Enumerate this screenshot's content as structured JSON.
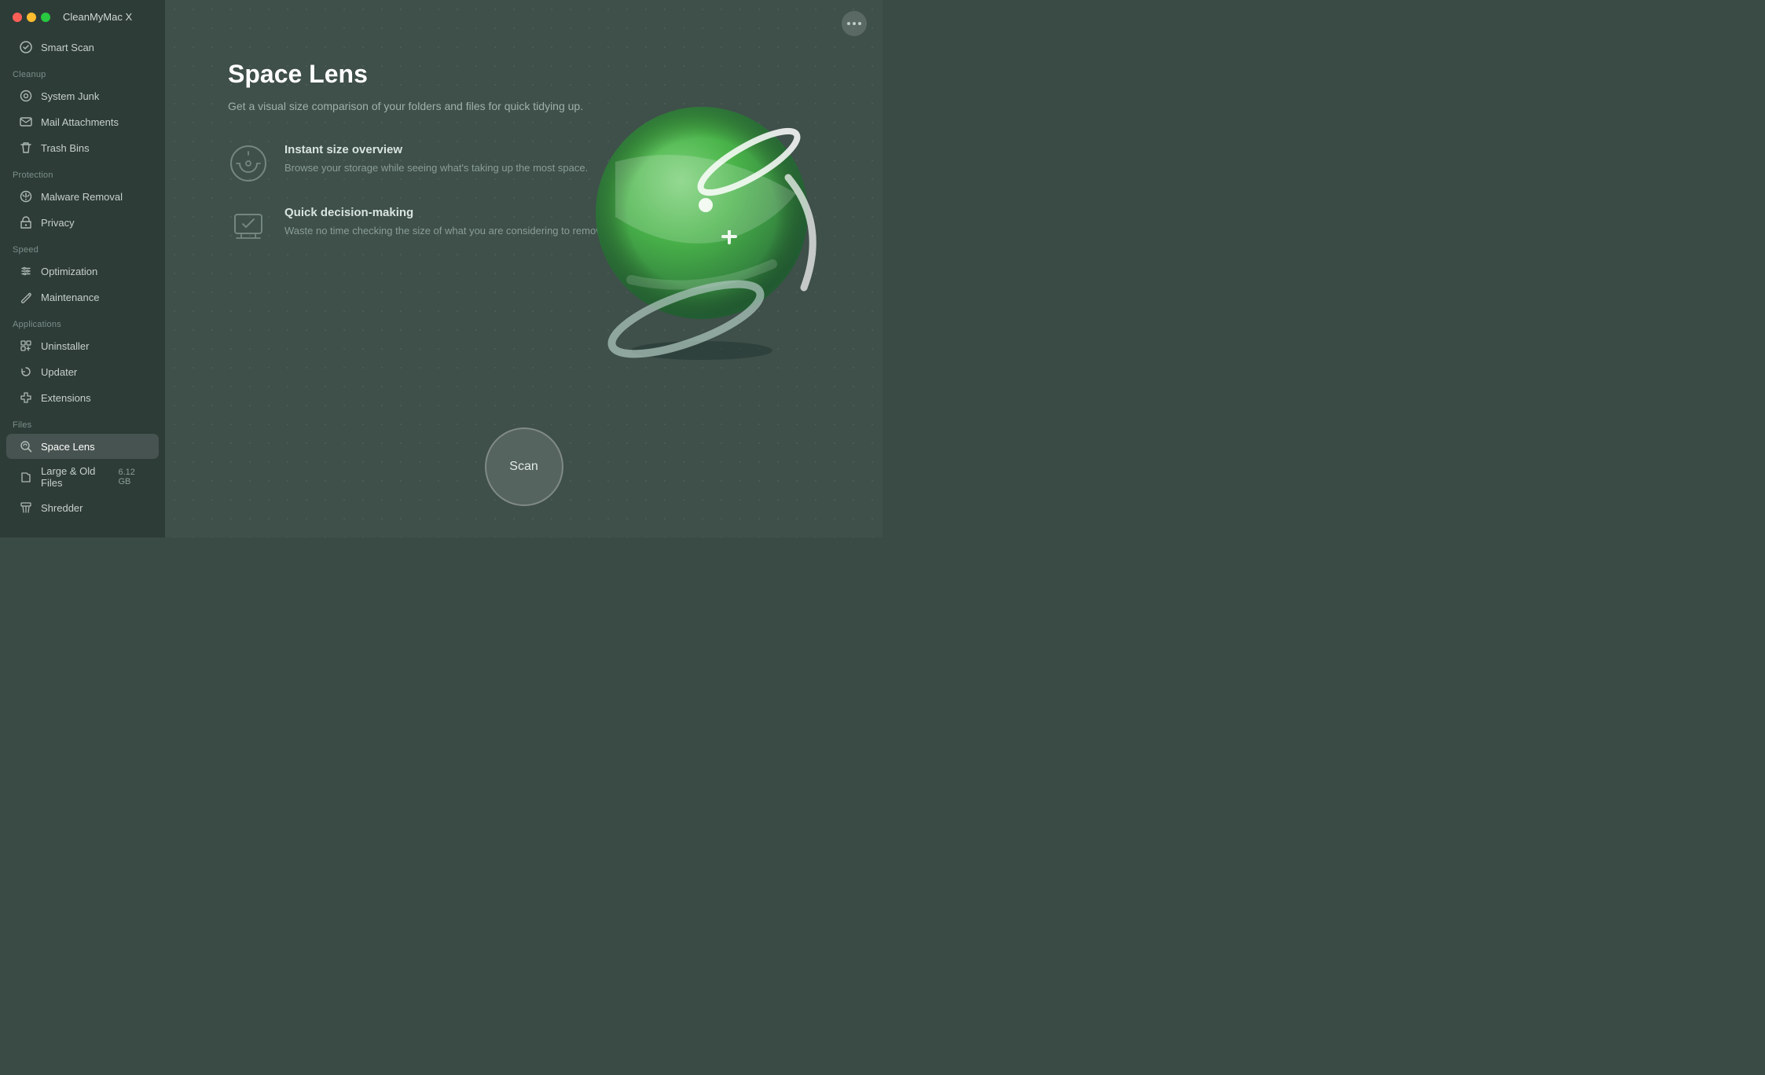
{
  "app": {
    "title": "CleanMyMac X"
  },
  "sidebar": {
    "smart_scan_label": "Smart Scan",
    "sections": [
      {
        "label": "Cleanup",
        "key": "cleanup",
        "items": [
          {
            "key": "system-junk",
            "label": "System Junk",
            "icon": "system-junk-icon"
          },
          {
            "key": "mail-attachments",
            "label": "Mail Attachments",
            "icon": "mail-icon"
          },
          {
            "key": "trash-bins",
            "label": "Trash Bins",
            "icon": "trash-icon"
          }
        ]
      },
      {
        "label": "Protection",
        "key": "protection",
        "items": [
          {
            "key": "malware-removal",
            "label": "Malware Removal",
            "icon": "malware-icon"
          },
          {
            "key": "privacy",
            "label": "Privacy",
            "icon": "privacy-icon"
          }
        ]
      },
      {
        "label": "Speed",
        "key": "speed",
        "items": [
          {
            "key": "optimization",
            "label": "Optimization",
            "icon": "optimization-icon"
          },
          {
            "key": "maintenance",
            "label": "Maintenance",
            "icon": "maintenance-icon"
          }
        ]
      },
      {
        "label": "Applications",
        "key": "applications",
        "items": [
          {
            "key": "uninstaller",
            "label": "Uninstaller",
            "icon": "uninstaller-icon"
          },
          {
            "key": "updater",
            "label": "Updater",
            "icon": "updater-icon"
          },
          {
            "key": "extensions",
            "label": "Extensions",
            "icon": "extensions-icon"
          }
        ]
      },
      {
        "label": "Files",
        "key": "files",
        "items": [
          {
            "key": "space-lens",
            "label": "Space Lens",
            "icon": "space-lens-icon",
            "active": true
          },
          {
            "key": "large-old-files",
            "label": "Large & Old Files",
            "icon": "large-files-icon",
            "badge": "6.12 GB"
          },
          {
            "key": "shredder",
            "label": "Shredder",
            "icon": "shredder-icon"
          }
        ]
      }
    ]
  },
  "main": {
    "title": "Space Lens",
    "subtitle": "Get a visual size comparison of your folders and files for quick tidying up.",
    "features": [
      {
        "key": "instant-size",
        "title": "Instant size overview",
        "description": "Browse your storage while seeing what's taking up the most space."
      },
      {
        "key": "quick-decision",
        "title": "Quick decision-making",
        "description": "Waste no time checking the size of what you are considering to remove."
      }
    ],
    "scan_button_label": "Scan"
  }
}
